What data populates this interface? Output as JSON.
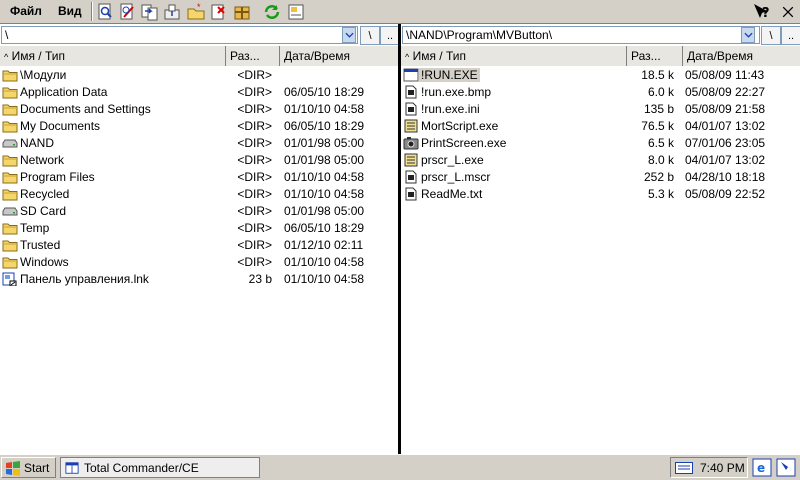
{
  "menu": {
    "file": "Файл",
    "view": "Вид"
  },
  "toolbar": {
    "icons": [
      "view-icon",
      "edit-icon",
      "copy-icon",
      "move-icon",
      "new-folder-icon",
      "delete-icon",
      "pack-icon",
      "refresh-icon",
      "properties-icon"
    ]
  },
  "left": {
    "path": "\\",
    "headers": {
      "name": "Имя / Тип",
      "size": "Раз...",
      "date": "Дата/Время"
    },
    "rows": [
      {
        "name": "\\Модули",
        "size": "<DIR>",
        "date": "",
        "icon": "folder-icon"
      },
      {
        "name": "Application Data",
        "size": "<DIR>",
        "date": "06/05/10 18:29",
        "icon": "folder-icon"
      },
      {
        "name": "Documents and Settings",
        "size": "<DIR>",
        "date": "01/10/10 04:58",
        "icon": "folder-icon"
      },
      {
        "name": "My Documents",
        "size": "<DIR>",
        "date": "06/05/10 18:29",
        "icon": "folder-icon"
      },
      {
        "name": "NAND",
        "size": "<DIR>",
        "date": "01/01/98 05:00",
        "icon": "drive-icon"
      },
      {
        "name": "Network",
        "size": "<DIR>",
        "date": "01/01/98 05:00",
        "icon": "folder-icon"
      },
      {
        "name": "Program Files",
        "size": "<DIR>",
        "date": "01/10/10 04:58",
        "icon": "folder-icon"
      },
      {
        "name": "Recycled",
        "size": "<DIR>",
        "date": "01/10/10 04:58",
        "icon": "folder-icon"
      },
      {
        "name": "SD Card",
        "size": "<DIR>",
        "date": "01/01/98 05:00",
        "icon": "drive-icon"
      },
      {
        "name": "Temp",
        "size": "<DIR>",
        "date": "06/05/10 18:29",
        "icon": "folder-icon"
      },
      {
        "name": "Trusted",
        "size": "<DIR>",
        "date": "01/12/10 02:11",
        "icon": "folder-icon"
      },
      {
        "name": "Windows",
        "size": "<DIR>",
        "date": "01/10/10 04:58",
        "icon": "folder-icon"
      },
      {
        "name": "Панель управления.lnk",
        "size": "23 b",
        "date": "01/10/10 04:58",
        "icon": "shortcut-icon"
      }
    ]
  },
  "right": {
    "path": "\\NAND\\Program\\MVButton\\",
    "headers": {
      "name": "Имя / Тип",
      "size": "Раз...",
      "date": "Дата/Время"
    },
    "rows": [
      {
        "name": "!RUN.EXE",
        "size": "18.5 k",
        "date": "05/08/09 11:43",
        "icon": "exe-icon",
        "selected": true
      },
      {
        "name": "!run.exe.bmp",
        "size": "6.0 k",
        "date": "05/08/09 22:27",
        "icon": "file-icon"
      },
      {
        "name": "!run.exe.ini",
        "size": "135 b",
        "date": "05/08/09 21:58",
        "icon": "file-icon"
      },
      {
        "name": "MortScript.exe",
        "size": "76.5 k",
        "date": "04/01/07 13:02",
        "icon": "script-icon"
      },
      {
        "name": "PrintScreen.exe",
        "size": "6.5 k",
        "date": "07/01/06 23:05",
        "icon": "camera-icon"
      },
      {
        "name": "prscr_L.exe",
        "size": "8.0 k",
        "date": "04/01/07 13:02",
        "icon": "script-icon"
      },
      {
        "name": "prscr_L.mscr",
        "size": "252 b",
        "date": "04/28/10 18:18",
        "icon": "file-icon"
      },
      {
        "name": "ReadMe.txt",
        "size": "5.3 k",
        "date": "05/08/09 22:52",
        "icon": "file-icon"
      }
    ]
  },
  "path_buttons": {
    "root": "\\",
    "up": ".."
  },
  "taskbar": {
    "start": "Start",
    "task": "Total Commander/CE",
    "clock": "7:40 PM"
  },
  "colors": {
    "chrome": "#d4d0c8",
    "divider": "#000000",
    "selection": "#d4d0c8"
  }
}
